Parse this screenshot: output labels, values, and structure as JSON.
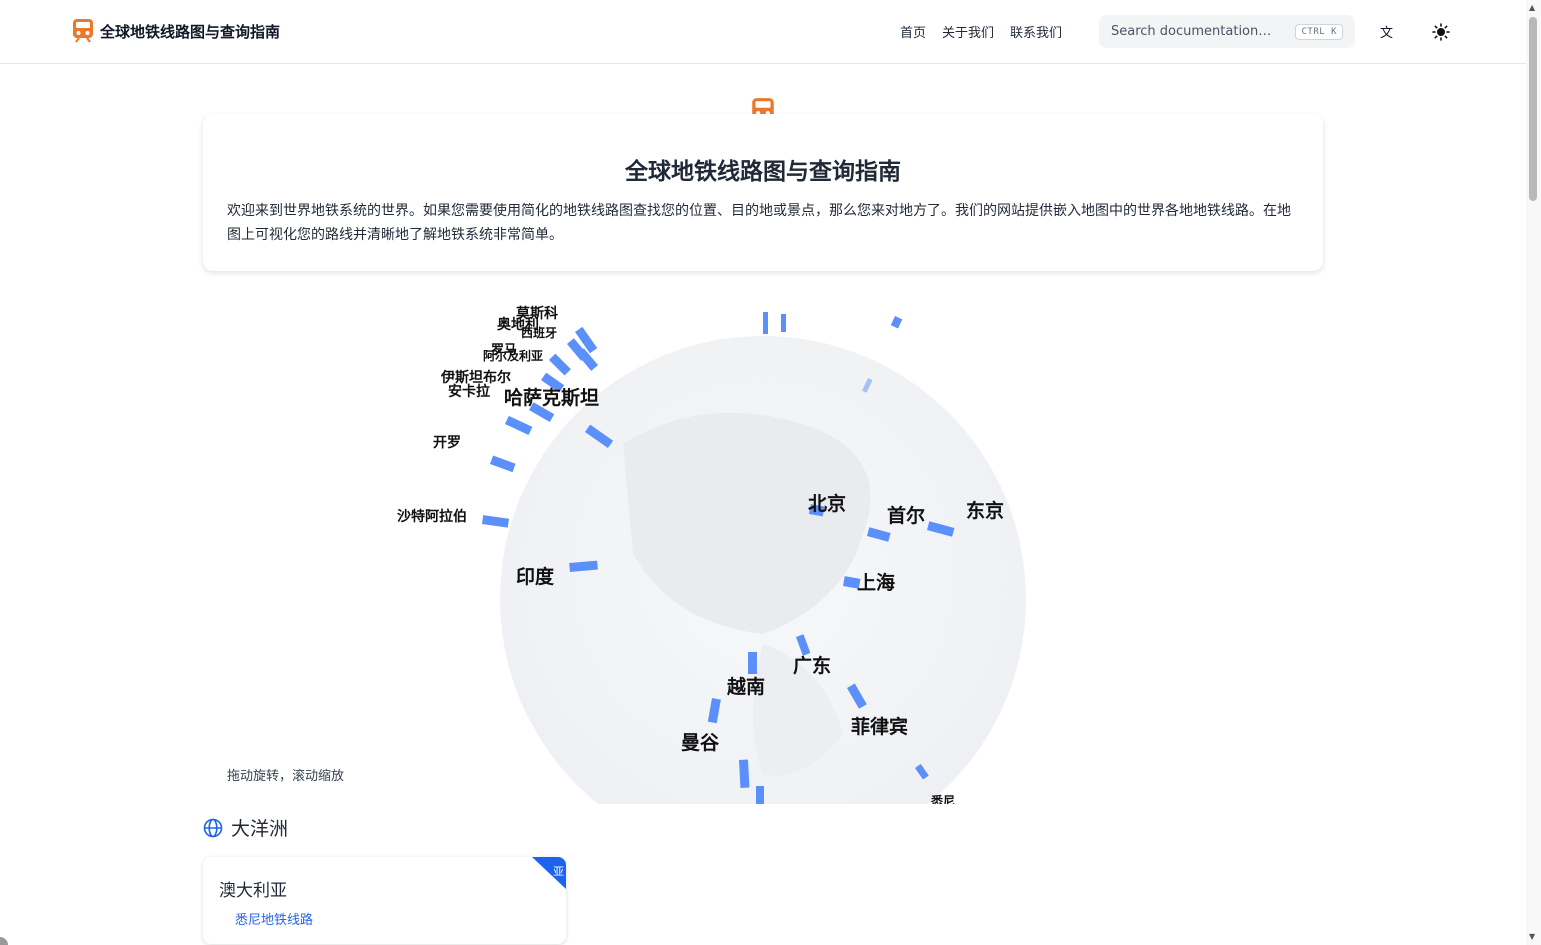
{
  "brand": {
    "title": "全球地铁线路图与查询指南",
    "icon": "train-icon",
    "color": "#ea7a2a"
  },
  "nav": {
    "links": [
      "首页",
      "关于我们",
      "联系我们"
    ]
  },
  "search": {
    "placeholder": "Search documentation…",
    "shortcut": "CTRL K"
  },
  "lang_label": "文",
  "theme_icon": "sun-icon",
  "hero": {
    "title": "全球地铁线路图与查询指南",
    "description": "欢迎来到世界地铁系统的世界。如果您需要使用简化的地铁线路图查找您的位置、目的地或景点，那么您来对地方了。我们的网站提供嵌入地图中的世界各地地铁线路。在地图上可视化您的路线并清晰地了解地铁系统非常简单。"
  },
  "globe": {
    "hint": "拖动旋转，滚动缩放",
    "accent": "#5b8ff9",
    "labels_large": [
      "北京",
      "首尔",
      "东京",
      "上海",
      "印度",
      "广东",
      "越南",
      "菲律宾",
      "曼谷",
      "哈萨克斯坦"
    ],
    "labels_small": [
      "莫斯科",
      "奥地利",
      "西班牙",
      "罗马",
      "阿尔及利亚",
      "伊斯坦布尔",
      "安卡拉",
      "开罗",
      "沙特阿拉伯",
      "悉尼"
    ]
  },
  "sections": [
    {
      "title": "大洋洲",
      "icon": "globe-icon",
      "cards": [
        {
          "country": "澳大利亚",
          "city_link": "悉尼地铁线路",
          "ribbon": "亚"
        }
      ]
    }
  ]
}
